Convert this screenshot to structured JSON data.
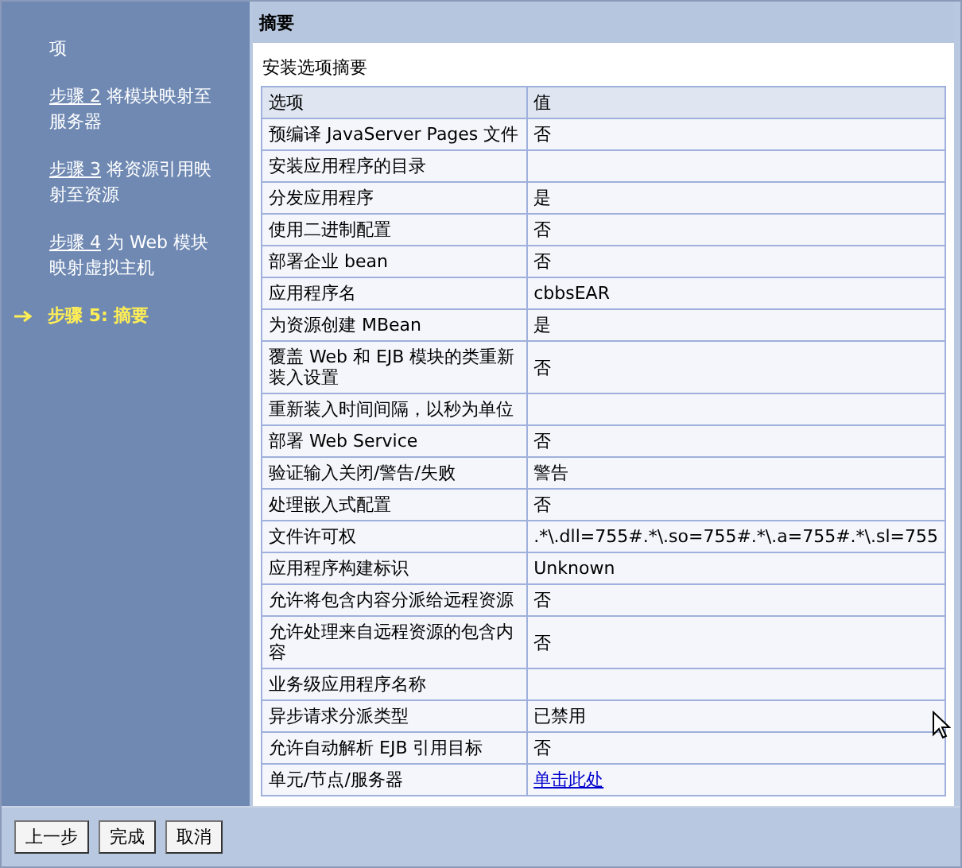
{
  "sidebar": {
    "steps": [
      {
        "text": "项",
        "selected": false
      },
      {
        "label": "步骤 2",
        "text": "将模块映射至服务器",
        "selected": false
      },
      {
        "label": "步骤 3",
        "text": "将资源引用映射至资源",
        "selected": false
      },
      {
        "label": "步骤 4",
        "text": "为 Web 模块映射虚拟主机",
        "selected": false
      },
      {
        "label": "步骤 5:",
        "text": "摘要",
        "selected": true
      }
    ]
  },
  "panel": {
    "title": "摘要",
    "subtitle": "安装选项摘要",
    "table": {
      "columns": [
        "选项",
        "值"
      ],
      "rows": [
        [
          "预编译 JavaServer Pages 文件",
          "否"
        ],
        [
          "安装应用程序的目录",
          ""
        ],
        [
          "分发应用程序",
          "是"
        ],
        [
          "使用二进制配置",
          "否"
        ],
        [
          "部署企业 bean",
          "否"
        ],
        [
          "应用程序名",
          "cbbsEAR"
        ],
        [
          "为资源创建 MBean",
          "是"
        ],
        [
          "覆盖 Web 和 EJB 模块的类重新装入设置",
          "否"
        ],
        [
          "重新装入时间间隔，以秒为单位",
          ""
        ],
        [
          "部署 Web Service",
          "否"
        ],
        [
          "验证输入关闭/警告/失败",
          "警告"
        ],
        [
          "处理嵌入式配置",
          "否"
        ],
        [
          "文件许可权",
          ".*\\.dll=755#.*\\.so=755#.*\\.a=755#.*\\.sl=755"
        ],
        [
          "应用程序构建标识",
          "Unknown"
        ],
        [
          "允许将包含内容分派给远程资源",
          "否"
        ],
        [
          "允许处理来自远程资源的包含内容",
          "否"
        ],
        [
          "业务级应用程序名称",
          ""
        ],
        [
          "异步请求分派类型",
          "已禁用"
        ],
        [
          "允许自动解析 EJB 引用目标",
          "否"
        ],
        [
          "单元/节点/服务器",
          {
            "link": "单击此处"
          }
        ]
      ]
    }
  },
  "buttons": [
    "上一步",
    "完成",
    "取消"
  ]
}
